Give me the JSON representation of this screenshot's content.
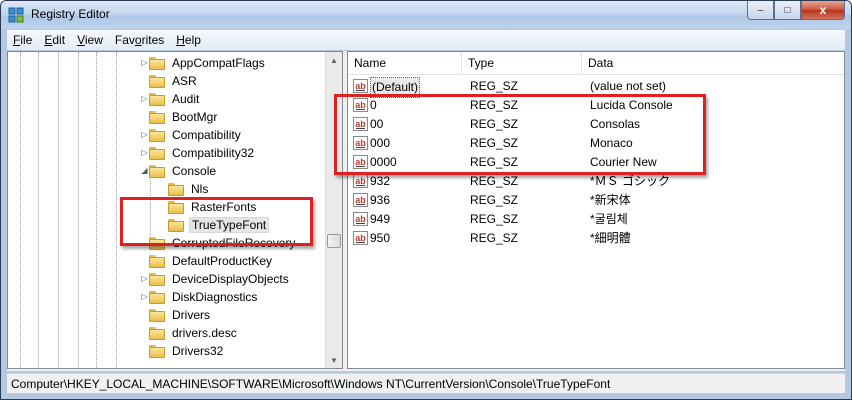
{
  "window": {
    "title": "Registry Editor",
    "buttons": {
      "minimize": "–",
      "maximize": "□",
      "close": "x"
    }
  },
  "menu": [
    {
      "underline": "F",
      "rest": "ile"
    },
    {
      "underline": "E",
      "rest": "dit"
    },
    {
      "underline": "V",
      "rest": "iew"
    },
    {
      "underline": "",
      "rest": "Fav",
      "underline2": "o",
      "rest2": "rites"
    },
    {
      "underline": "H",
      "rest": "elp"
    }
  ],
  "tree": {
    "items": [
      {
        "label": "AppCompatFlags",
        "expander": "▷"
      },
      {
        "label": "ASR",
        "expander": ""
      },
      {
        "label": "Audit",
        "expander": "▷"
      },
      {
        "label": "BootMgr",
        "expander": ""
      },
      {
        "label": "Compatibility",
        "expander": "▷"
      },
      {
        "label": "Compatibility32",
        "expander": "▷"
      },
      {
        "label": "Console",
        "expander": "◢"
      },
      {
        "label": "Nls",
        "expander": ""
      },
      {
        "label": "RasterFonts",
        "expander": ""
      },
      {
        "label": "TrueTypeFont",
        "expander": ""
      },
      {
        "label": "CorruptedFileRecovery",
        "expander": ""
      },
      {
        "label": "DefaultProductKey",
        "expander": ""
      },
      {
        "label": "DeviceDisplayObjects",
        "expander": "▷"
      },
      {
        "label": "DiskDiagnostics",
        "expander": "▷"
      },
      {
        "label": "Drivers",
        "expander": ""
      },
      {
        "label": "drivers.desc",
        "expander": ""
      },
      {
        "label": "Drivers32",
        "expander": ""
      }
    ],
    "selected": "TrueTypeFont"
  },
  "list": {
    "columns": [
      "Name",
      "Type",
      "Data"
    ],
    "rows": [
      {
        "name": "(Default)",
        "type": "REG_SZ",
        "data": "(value not set)"
      },
      {
        "name": "0",
        "type": "REG_SZ",
        "data": "Lucida Console"
      },
      {
        "name": "00",
        "type": "REG_SZ",
        "data": "Consolas"
      },
      {
        "name": "000",
        "type": "REG_SZ",
        "data": "Monaco"
      },
      {
        "name": "0000",
        "type": "REG_SZ",
        "data": "Courier New"
      },
      {
        "name": "932",
        "type": "REG_SZ",
        "data": "*ＭＳ ゴシック"
      },
      {
        "name": "936",
        "type": "REG_SZ",
        "data": "*新宋体"
      },
      {
        "name": "949",
        "type": "REG_SZ",
        "data": "*굴림체"
      },
      {
        "name": "950",
        "type": "REG_SZ",
        "data": "*細明體"
      }
    ],
    "value_icon": "string-value-icon",
    "value_icon_text": "ab"
  },
  "status_bar": "Computer\\HKEY_LOCAL_MACHINE\\SOFTWARE\\Microsoft\\Windows NT\\CurrentVersion\\Console\\TrueTypeFont",
  "colors": {
    "highlight_box": "#e02020"
  }
}
